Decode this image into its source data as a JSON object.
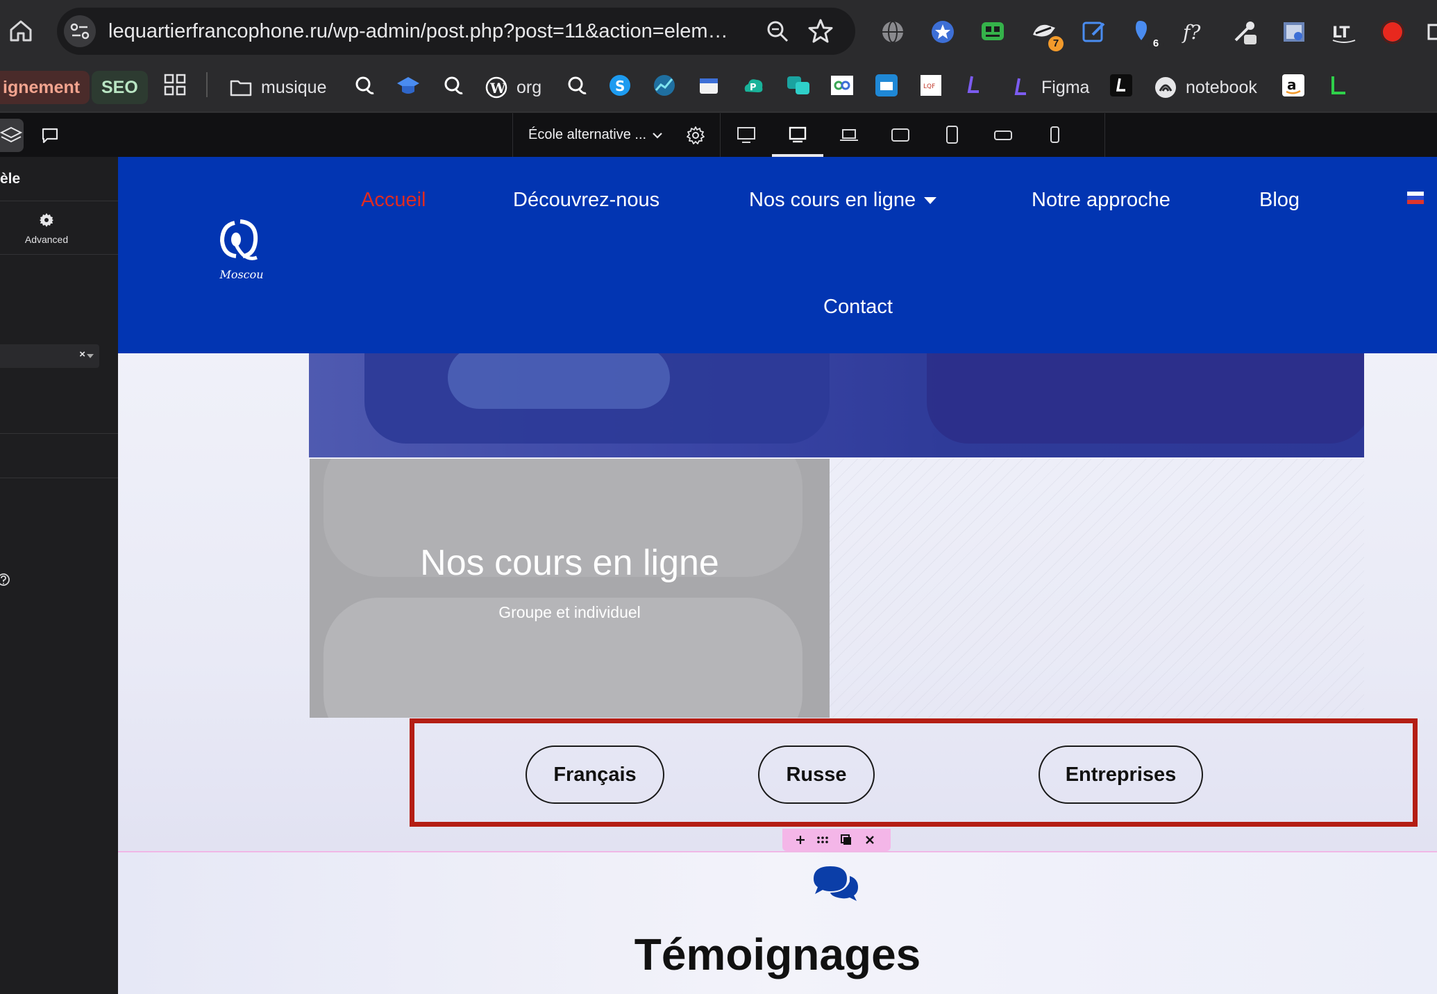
{
  "browser": {
    "url": "lequartierfrancophone.ru/wp-admin/post.php?post=11&action=elem…",
    "extension_badges": {
      "ext_3": "7",
      "ext_5": "6"
    },
    "bookmarks": [
      {
        "label": "ignement"
      },
      {
        "label": "SEO"
      },
      {
        "label": "musique"
      },
      {
        "label": "org"
      },
      {
        "label": "Figma"
      },
      {
        "label": "notebook"
      }
    ]
  },
  "editor": {
    "page_selector": "École alternative ...",
    "sidebar_title": "èle",
    "sidebar_tab": "Advanced",
    "select_clear": "×"
  },
  "site": {
    "logo_caption": "Moscou",
    "nav": [
      {
        "label": "Accueil"
      },
      {
        "label": "Découvrez-nous"
      },
      {
        "label": "Nos cours en ligne"
      },
      {
        "label": "Notre approche"
      },
      {
        "label": "Blog"
      },
      {
        "label": "Contact"
      }
    ],
    "course": {
      "title": "Nos cours en ligne",
      "subtitle": "Groupe et individuel"
    },
    "buttons": [
      {
        "label": "Français"
      },
      {
        "label": "Russe"
      },
      {
        "label": "Entreprises"
      }
    ],
    "testimonials_title": "Témoignages"
  },
  "colors": {
    "header_blue": "#0235b2",
    "nav_active": "#e02b20",
    "highlight_border": "#b41e14",
    "section_tools": "#f4b6e8",
    "editor_dark": "#1e1e20"
  }
}
